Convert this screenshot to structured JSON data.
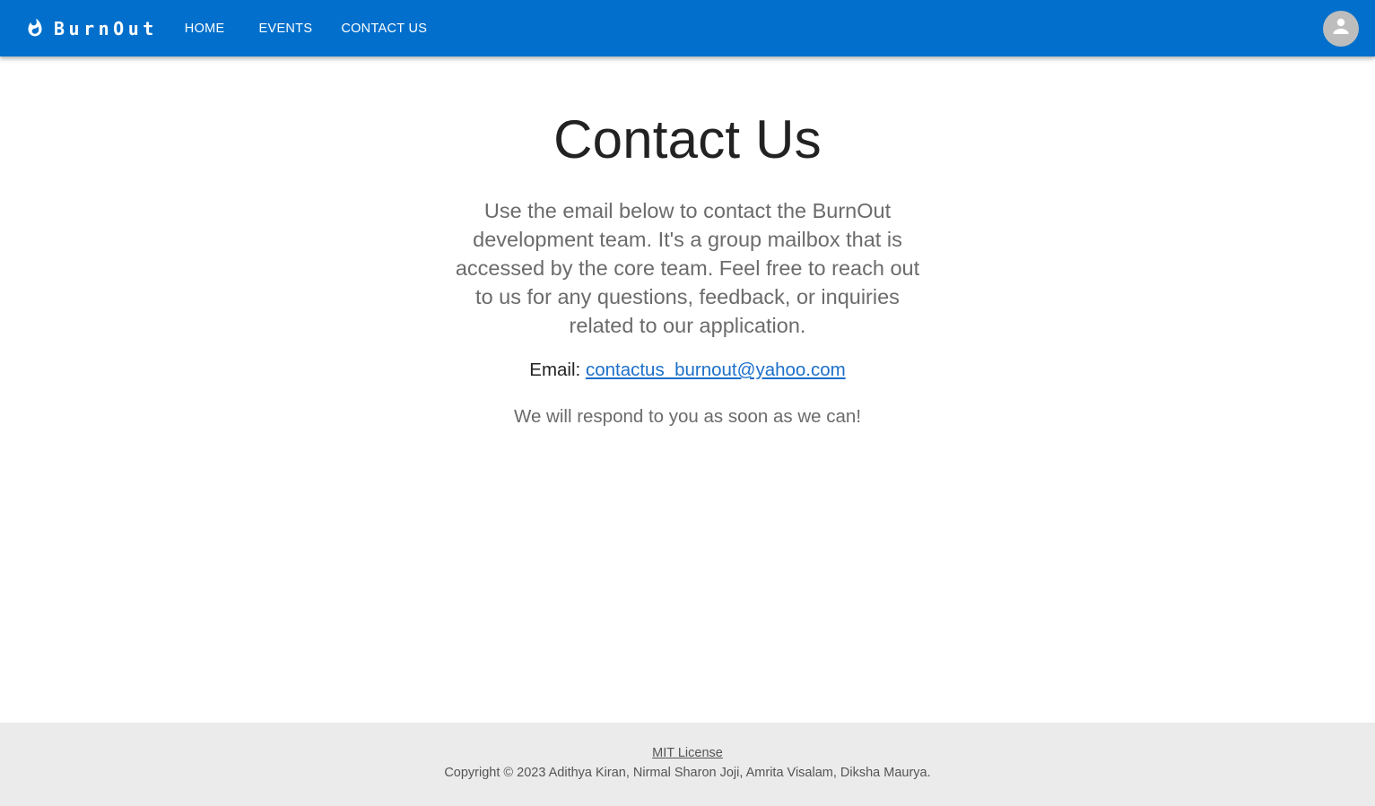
{
  "header": {
    "brand": "BurnOut",
    "nav": [
      {
        "label": "HOME"
      },
      {
        "label": "EVENTS"
      },
      {
        "label": "CONTACT US"
      }
    ],
    "background_color": "#016fcb"
  },
  "main": {
    "title": "Contact Us",
    "intro": "Use the email below to contact the BurnOut development team. It's a group mailbox that is accessed by the core team. Feel free to reach out to us for any questions, feedback, or inquiries related to our application.",
    "email_label": "Email:",
    "email_address": "contactus_burnout@yahoo.com",
    "respond_text": "We will respond to you as soon as we can!"
  },
  "footer": {
    "license": "MIT License",
    "copyright": "Copyright © 2023 Adithya Kiran, Nirmal Sharon Joji, Amrita Visalam, Diksha Maurya."
  },
  "icons": {
    "brand": "flame-icon",
    "account": "account-circle-icon"
  }
}
